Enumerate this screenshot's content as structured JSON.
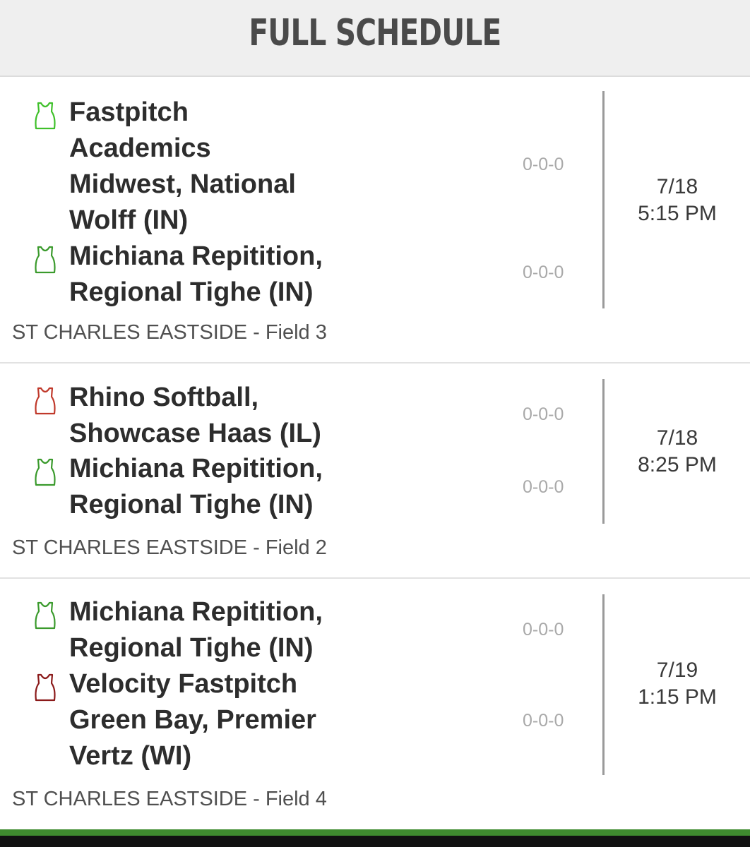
{
  "header": {
    "title": "FULL SCHEDULE"
  },
  "colors": {
    "green_icon": "#3fae2a",
    "red_icon": "#c0392b",
    "dark_red_icon": "#8b1a1a",
    "footer_green": "#3f8b2f"
  },
  "games": [
    {
      "home": {
        "name": "Fastpitch\nAcademics\nMidwest, National\nWolff (IN)",
        "record": "0-0-0",
        "icon": "jersey-green-icon"
      },
      "away": {
        "name": "Michiana Repitition,\nRegional Tighe (IN)",
        "record": "0-0-0",
        "icon": "jersey-green-icon"
      },
      "date": "7/18",
      "time": "5:15 PM",
      "location": "ST CHARLES EASTSIDE - Field 3"
    },
    {
      "home": {
        "name": "Rhino Softball,\nShowcase Haas (IL)",
        "record": "0-0-0",
        "icon": "jersey-red-icon"
      },
      "away": {
        "name": "Michiana Repitition,\nRegional Tighe (IN)",
        "record": "0-0-0",
        "icon": "jersey-green-icon"
      },
      "date": "7/18",
      "time": "8:25 PM",
      "location": "ST CHARLES EASTSIDE - Field 2"
    },
    {
      "home": {
        "name": "Michiana Repitition,\nRegional Tighe (IN)",
        "record": "0-0-0",
        "icon": "jersey-green-icon"
      },
      "away": {
        "name": "Velocity Fastpitch\nGreen Bay, Premier\nVertz (WI)",
        "record": "0-0-0",
        "icon": "jersey-dark-red-icon"
      },
      "date": "7/19",
      "time": "1:15 PM",
      "location": "ST CHARLES EASTSIDE - Field 4"
    }
  ]
}
